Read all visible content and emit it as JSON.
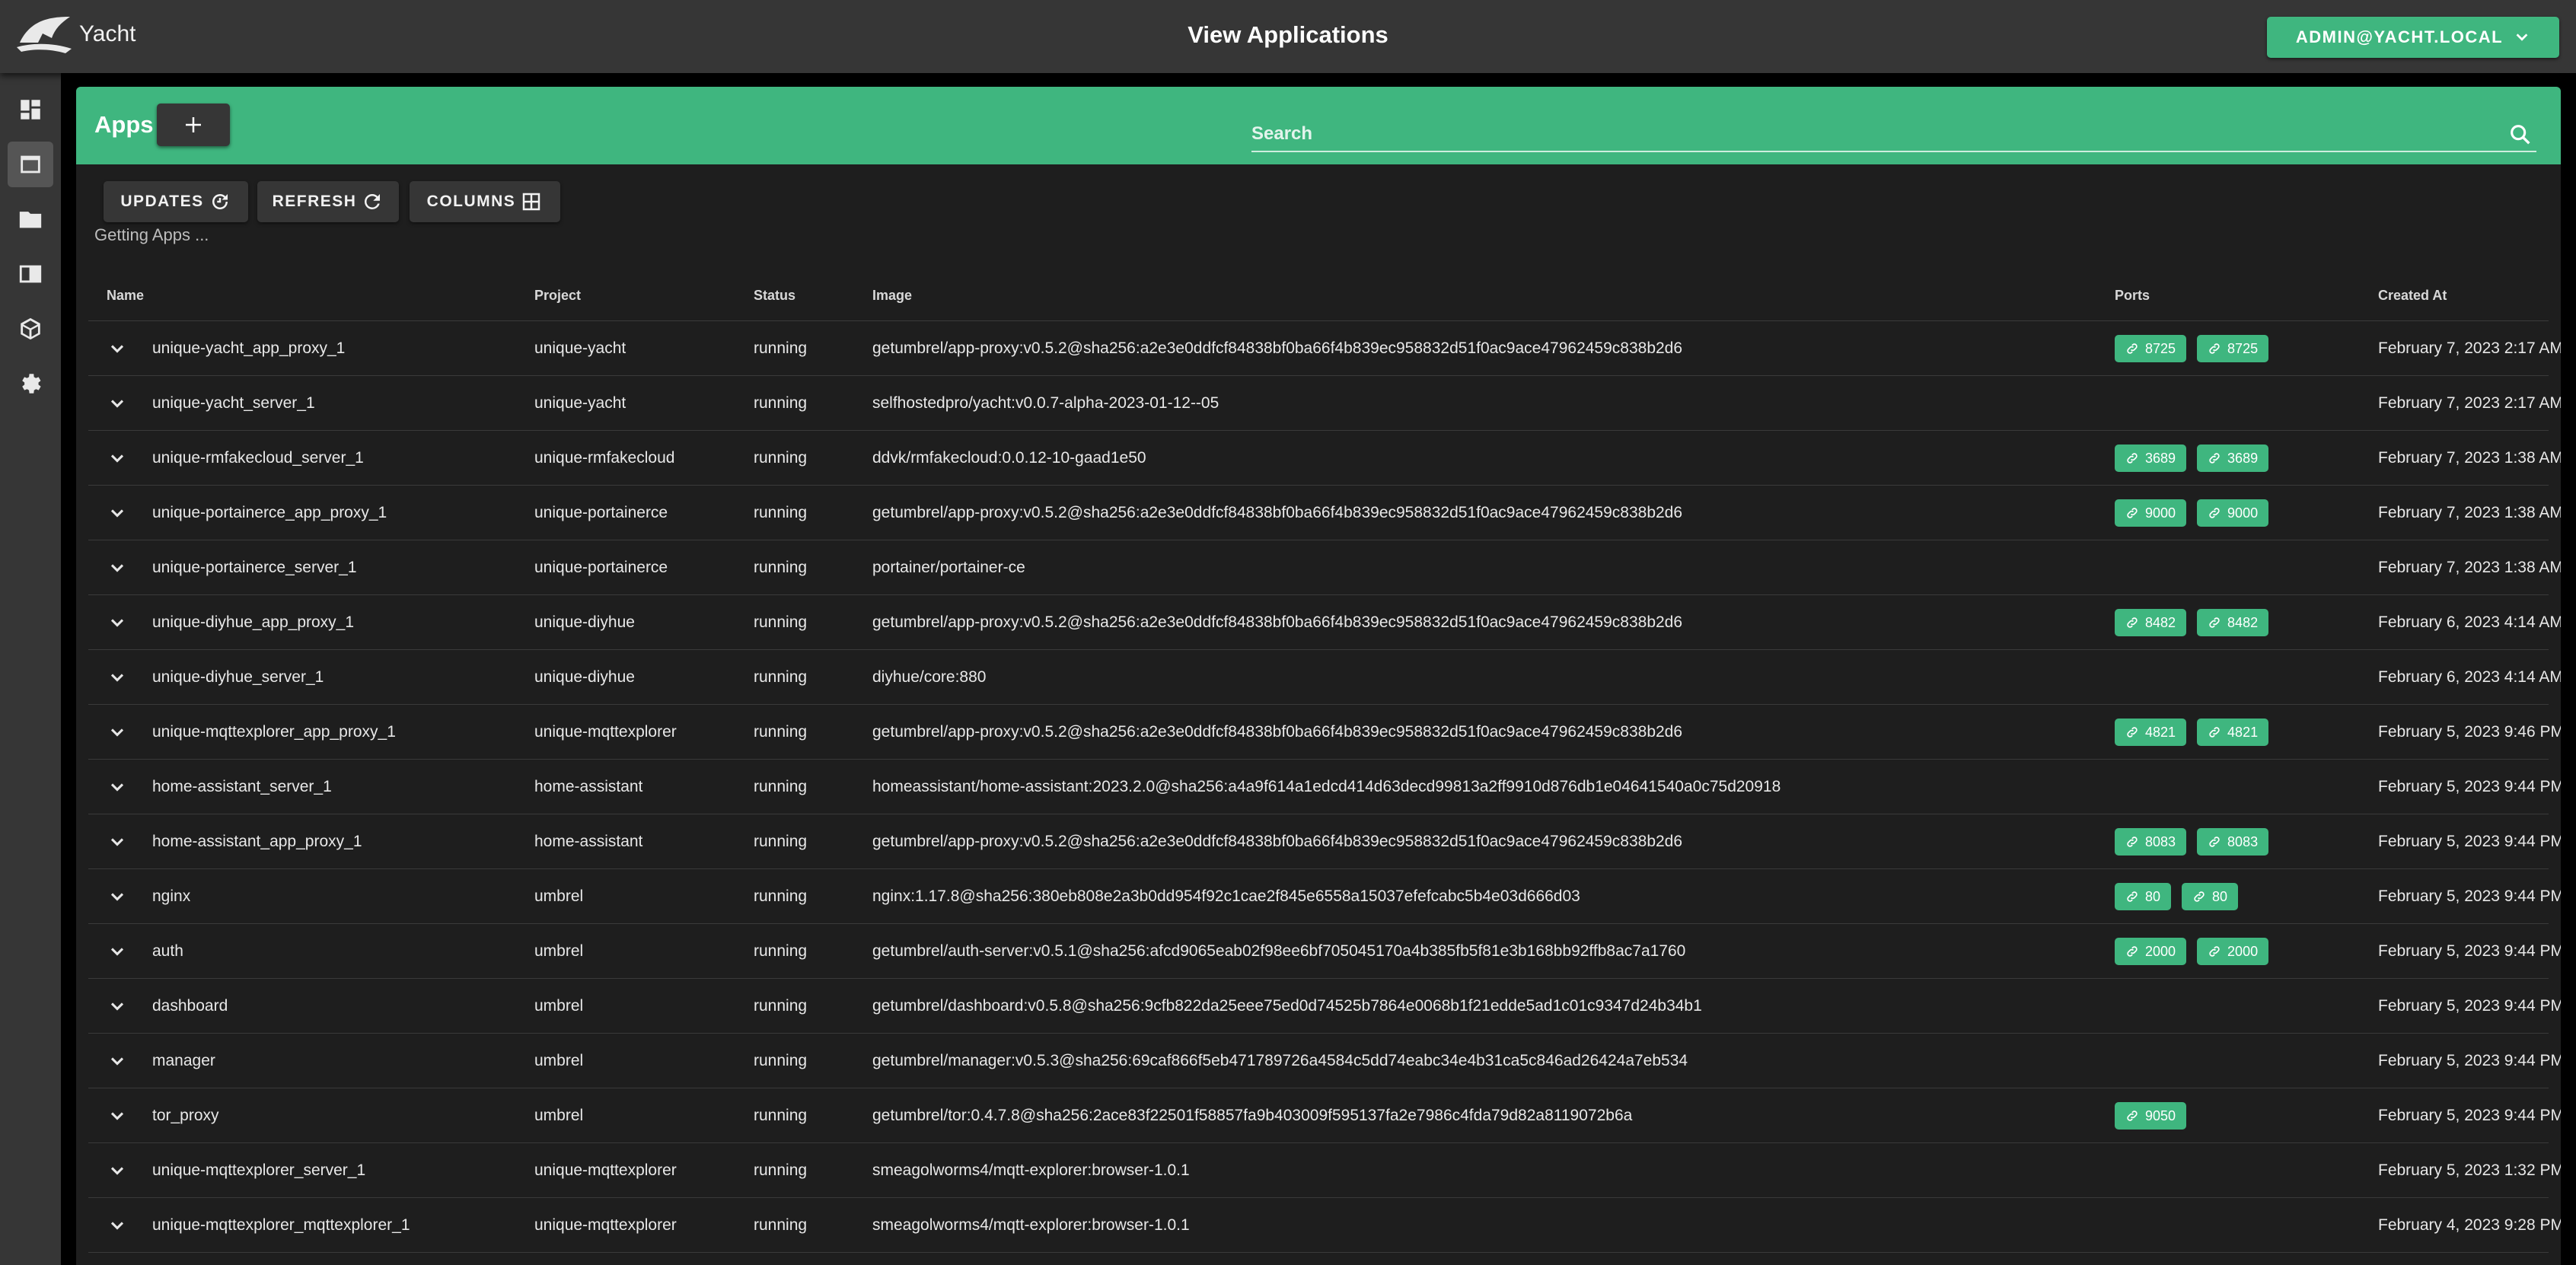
{
  "app": {
    "brand": "Yacht",
    "page_title": "View Applications",
    "user": "ADMIN@YACHT.LOCAL"
  },
  "sidebar": {
    "items": [
      {
        "name": "dashboard-icon",
        "active": false
      },
      {
        "name": "applications-icon",
        "active": true
      },
      {
        "name": "folder-icon",
        "active": false
      },
      {
        "name": "templates-icon",
        "active": false
      },
      {
        "name": "resources-icon",
        "active": false
      },
      {
        "name": "settings-icon",
        "active": false
      }
    ]
  },
  "apps_header": {
    "title": "Apps",
    "add_icon": "plus-icon",
    "search_placeholder": "Search"
  },
  "toolbar": {
    "updates_label": "UPDATES",
    "refresh_label": "REFRESH",
    "columns_label": "COLUMNS",
    "loading_text": "Getting Apps ..."
  },
  "table": {
    "headers": {
      "name": "Name",
      "project": "Project",
      "status": "Status",
      "image": "Image",
      "ports": "Ports",
      "created": "Created At"
    },
    "rows": [
      {
        "name": "unique-yacht_app_proxy_1",
        "project": "unique-yacht",
        "status": "running",
        "image": "getumbrel/app-proxy:v0.5.2@sha256:a2e3e0ddfcf84838bf0ba66f4b839ec958832d51f0ac9ace47962459c838b2d6",
        "ports": [
          "8725",
          "8725"
        ],
        "created": "February 7, 2023 2:17 AM"
      },
      {
        "name": "unique-yacht_server_1",
        "project": "unique-yacht",
        "status": "running",
        "image": "selfhostedpro/yacht:v0.0.7-alpha-2023-01-12--05",
        "ports": [],
        "created": "February 7, 2023 2:17 AM"
      },
      {
        "name": "unique-rmfakecloud_server_1",
        "project": "unique-rmfakecloud",
        "status": "running",
        "image": "ddvk/rmfakecloud:0.0.12-10-gaad1e50",
        "ports": [
          "3689",
          "3689"
        ],
        "created": "February 7, 2023 1:38 AM"
      },
      {
        "name": "unique-portainerce_app_proxy_1",
        "project": "unique-portainerce",
        "status": "running",
        "image": "getumbrel/app-proxy:v0.5.2@sha256:a2e3e0ddfcf84838bf0ba66f4b839ec958832d51f0ac9ace47962459c838b2d6",
        "ports": [
          "9000",
          "9000"
        ],
        "created": "February 7, 2023 1:38 AM"
      },
      {
        "name": "unique-portainerce_server_1",
        "project": "unique-portainerce",
        "status": "running",
        "image": "portainer/portainer-ce",
        "ports": [],
        "created": "February 7, 2023 1:38 AM"
      },
      {
        "name": "unique-diyhue_app_proxy_1",
        "project": "unique-diyhue",
        "status": "running",
        "image": "getumbrel/app-proxy:v0.5.2@sha256:a2e3e0ddfcf84838bf0ba66f4b839ec958832d51f0ac9ace47962459c838b2d6",
        "ports": [
          "8482",
          "8482"
        ],
        "created": "February 6, 2023 4:14 AM"
      },
      {
        "name": "unique-diyhue_server_1",
        "project": "unique-diyhue",
        "status": "running",
        "image": "diyhue/core:880",
        "ports": [],
        "created": "February 6, 2023 4:14 AM"
      },
      {
        "name": "unique-mqttexplorer_app_proxy_1",
        "project": "unique-mqttexplorer",
        "status": "running",
        "image": "getumbrel/app-proxy:v0.5.2@sha256:a2e3e0ddfcf84838bf0ba66f4b839ec958832d51f0ac9ace47962459c838b2d6",
        "ports": [
          "4821",
          "4821"
        ],
        "created": "February 5, 2023 9:46 PM"
      },
      {
        "name": "home-assistant_server_1",
        "project": "home-assistant",
        "status": "running",
        "image": "homeassistant/home-assistant:2023.2.0@sha256:a4a9f614a1edcd414d63decd99813a2ff9910d876db1e04641540a0c75d20918",
        "ports": [],
        "created": "February 5, 2023 9:44 PM"
      },
      {
        "name": "home-assistant_app_proxy_1",
        "project": "home-assistant",
        "status": "running",
        "image": "getumbrel/app-proxy:v0.5.2@sha256:a2e3e0ddfcf84838bf0ba66f4b839ec958832d51f0ac9ace47962459c838b2d6",
        "ports": [
          "8083",
          "8083"
        ],
        "created": "February 5, 2023 9:44 PM"
      },
      {
        "name": "nginx",
        "project": "umbrel",
        "status": "running",
        "image": "nginx:1.17.8@sha256:380eb808e2a3b0dd954f92c1cae2f845e6558a15037efefcabc5b4e03d666d03",
        "ports": [
          "80",
          "80"
        ],
        "created": "February 5, 2023 9:44 PM"
      },
      {
        "name": "auth",
        "project": "umbrel",
        "status": "running",
        "image": "getumbrel/auth-server:v0.5.1@sha256:afcd9065eab02f98ee6bf705045170a4b385fb5f81e3b168bb92ffb8ac7a1760",
        "ports": [
          "2000",
          "2000"
        ],
        "created": "February 5, 2023 9:44 PM"
      },
      {
        "name": "dashboard",
        "project": "umbrel",
        "status": "running",
        "image": "getumbrel/dashboard:v0.5.8@sha256:9cfb822da25eee75ed0d74525b7864e0068b1f21edde5ad1c01c9347d24b34b1",
        "ports": [],
        "created": "February 5, 2023 9:44 PM"
      },
      {
        "name": "manager",
        "project": "umbrel",
        "status": "running",
        "image": "getumbrel/manager:v0.5.3@sha256:69caf866f5eb471789726a4584c5dd74eabc34e4b31ca5c846ad26424a7eb534",
        "ports": [],
        "created": "February 5, 2023 9:44 PM"
      },
      {
        "name": "tor_proxy",
        "project": "umbrel",
        "status": "running",
        "image": "getumbrel/tor:0.4.7.8@sha256:2ace83f22501f58857fa9b403009f595137fa2e7986c4fda79d82a8119072b6a",
        "ports": [
          "9050"
        ],
        "created": "February 5, 2023 9:44 PM"
      },
      {
        "name": "unique-mqttexplorer_server_1",
        "project": "unique-mqttexplorer",
        "status": "running",
        "image": "smeagolworms4/mqtt-explorer:browser-1.0.1",
        "ports": [],
        "created": "February 5, 2023 1:32 PM"
      },
      {
        "name": "unique-mqttexplorer_mqttexplorer_1",
        "project": "unique-mqttexplorer",
        "status": "running",
        "image": "smeagolworms4/mqtt-explorer:browser-1.0.1",
        "ports": [],
        "created": "February 4, 2023 9:28 PM"
      }
    ]
  },
  "colors": {
    "accent": "#3fb67f",
    "surface": "#1e1e1e",
    "bar": "#363636"
  }
}
